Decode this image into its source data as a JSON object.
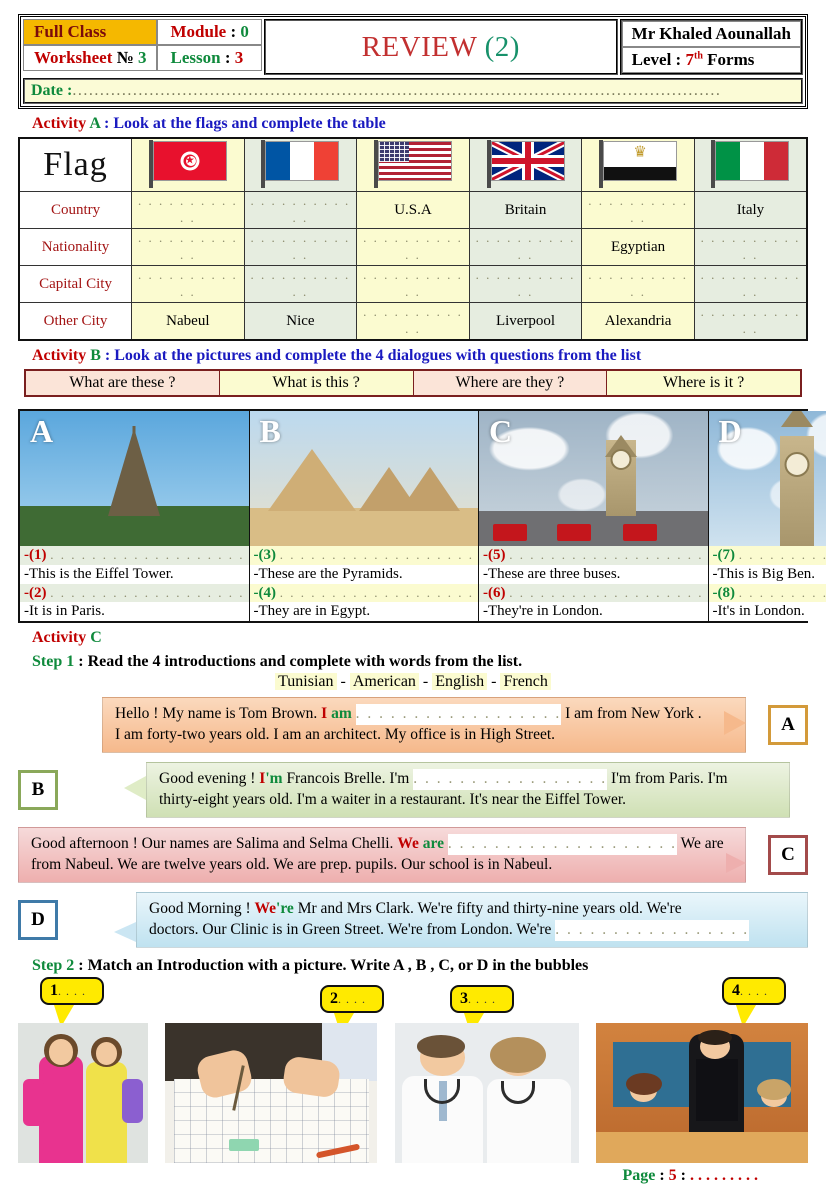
{
  "header": {
    "full_class": "Full Class",
    "worksheet_label": "Worksheet",
    "worksheet_no_symbol": "№",
    "worksheet_no": "3",
    "module_label": "Module",
    "module_value": "0",
    "lesson_label": "Lesson",
    "lesson_value": "3",
    "title": "REVIEW",
    "title_number": "(2)",
    "teacher": "Mr Khaled Aounallah",
    "level_label": "Level :",
    "level_value": "7",
    "level_sup": "th",
    "level_forms": "Forms",
    "date_label": "Date :",
    "date_dots": "......................................................................................................................"
  },
  "activity_a": {
    "tag": "Activity",
    "letter": "A",
    "instruction": ": Look at the flags and complete the table",
    "flag_header": "Flag",
    "row_labels": [
      "Country",
      "Nationality",
      "Capital City",
      "Other City"
    ],
    "blank": ". . . . . . . . . . . .",
    "flags": [
      "tunisia-flag",
      "france-flag",
      "usa-flag",
      "uk-flag",
      "egypt-flag",
      "italy-flag"
    ],
    "rows": [
      {
        "label": "Country",
        "cells": [
          ". . . . . . . . . . . .",
          ". . . . . . . . . . . .",
          "U.S.A",
          "Britain",
          ". . . . . . . . . . . .",
          "Italy"
        ]
      },
      {
        "label": "Nationality",
        "cells": [
          ". . . . . . . . . . . .",
          ". . . . . . . . . . . .",
          ". . . . . . . . . . . .",
          ". . . . . . . . . . . .",
          "Egyptian",
          ". . . . . . . . . . . ."
        ]
      },
      {
        "label": "Capital City",
        "cells": [
          ". . . . . . . . . . . .",
          ". . . . . . . . . . . .",
          ". . . . . . . . . . . .",
          ". . . . . . . . . . . .",
          ". . . . . . . . . . . .",
          ". . . . . . . . . . . ."
        ]
      },
      {
        "label": "Other City",
        "cells": [
          "Nabeul",
          "Nice",
          ". . . . . . . . . . . .",
          "Liverpool",
          "Alexandria",
          ". . . . . . . . . . . ."
        ]
      }
    ]
  },
  "activity_b": {
    "tag": "Activity",
    "letter": "B",
    "instruction": ": Look at the pictures and complete the 4 dialogues with questions from the list",
    "questions": [
      "What are these ?",
      "What is this ?",
      "Where are they ?",
      "Where is it ?"
    ],
    "pictures": [
      {
        "letter": "A",
        "image": "eiffel-tower-photo",
        "q_num": "-(1)",
        "q_dots": ". . . . . . . . . . . . . . . . . . .",
        "answer": "-This is the Eiffel Tower.",
        "q2_num": "-(2)",
        "q2_dots": ". . . . . . . . . . . . . . . . . . .",
        "answer2": "-It is in Paris."
      },
      {
        "letter": "B",
        "image": "pyramids-photo",
        "q_num": "-(3)",
        "q_dots": ". . . . . . . . . . . . . . . . . . .",
        "answer": "-These are the Pyramids.",
        "q2_num": "-(4)",
        "q2_dots": ". . . . . . . . . . . . . . . . . . .",
        "answer2": "-They are in Egypt."
      },
      {
        "letter": "C",
        "image": "london-buses-bigben-photo",
        "q_num": "-(5)",
        "q_dots": ". . . . . . . . . . . . . . . . . . .",
        "answer": "-These are three buses.",
        "q2_num": "-(6)",
        "q2_dots": ". . . . . . . . . . . . . . . . . . .",
        "answer2": "-They're in London."
      },
      {
        "letter": "D",
        "image": "big-ben-photo",
        "q_num": "-(7)",
        "q_dots": ". . . . . . . . . . . . . .",
        "answer": "-This is Big Ben.",
        "q2_num": "-(8)",
        "q2_dots": ". . . . . . . . . . . . . .",
        "answer2": "-It's in London."
      }
    ]
  },
  "activity_c": {
    "tag": "Activity",
    "letter": "C",
    "step1_label": "Step 1",
    "step1_instruction": ": Read the 4 introductions and complete with words from the list.",
    "word_list": [
      "Tunisian",
      "American",
      "English",
      "French"
    ],
    "word_separator": "-",
    "bubbles": [
      {
        "tag": "A",
        "line1_pre": "Hello ! My name is Tom Brown.",
        "bold_red": "I",
        "bold_green": "am",
        "blank": ". . . . . . . . . . . . . . . . . .",
        "line1_post": "I am from New York .",
        "line2": "I am forty-two years old. I am an architect. My office is in High Street."
      },
      {
        "tag": "B",
        "line1_pre": "Good evening !",
        "bold_red": "I",
        "bold_green": "'m",
        "mid": "Francois Brelle. I'm",
        "blank": ". . . . . . . . . . . . . . . . .",
        "line1_post": "I'm from Paris. I'm",
        "line2": "thirty-eight years old. I'm a waiter in a restaurant. It's near the Eiffel Tower."
      },
      {
        "tag": "C",
        "line1_pre": "Good afternoon ! Our names are Salima and Selma Chelli.",
        "bold_red": "We",
        "bold_green": "are",
        "blank": ". . . . . . . . . . . . . . . . . . . .",
        "line1_post": "We are",
        "line2": "from Nabeul. We are twelve years old. We are prep. pupils. Our school is in Nabeul."
      },
      {
        "tag": "D",
        "line1_pre": "Good Morning !",
        "bold_red": "We",
        "bold_green": "'re",
        "line1_post": "Mr and Mrs Clark. We're fifty and thirty-nine years old. We're",
        "line2_pre": "doctors. Our Clinic is in Green Street. We're from London. We're",
        "blank": ". . . . . . . . . . . . . . . . ."
      }
    ],
    "step2_label": "Step 2",
    "step2_instruction": ": Match an Introduction with a picture. Write A , B , C, or D in the bubbles",
    "callouts": [
      {
        "num": "1",
        "dots": ". . . ."
      },
      {
        "num": "2",
        "dots": ". . . ."
      },
      {
        "num": "3",
        "dots": ". . . ."
      },
      {
        "num": "4",
        "dots": ". . . ."
      }
    ],
    "photos": [
      "two-schoolgirls-photo",
      "architect-drafting-photo",
      "two-doctors-photo",
      "waiter-restaurant-photo"
    ]
  },
  "footer": {
    "page_label": "Page",
    "colon1": ":",
    "page_number": "5",
    "colon2": ":",
    "dots": ". . . . . . . . ."
  },
  "colors": {
    "accent_red": "#c00000",
    "accent_green": "#0f8a3c",
    "accent_blue": "#1a1ac0",
    "highlight_yellow": "#f5b800",
    "cell_cream": "#fbfbd0",
    "cell_green": "#e6ede0",
    "callout_yellow": "#ffea00"
  }
}
